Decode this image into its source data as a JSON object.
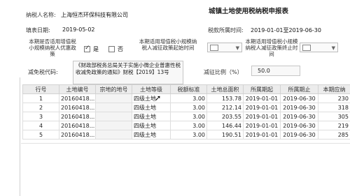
{
  "header": {
    "title": "城镇土地使用税纳税申报表",
    "taxpayer_label": "纳税人名称:",
    "taxpayer_name": "上海恒杰环保科技有限公司",
    "fill_date_label": "填表日期:",
    "fill_date": "2019-05-02",
    "period_label": "税款所属时间:",
    "period_value": "2019-01-01至2019-06-30"
  },
  "form": {
    "small_taxpayer_label": "本期是否适用增值税小规模纳税人优惠政策",
    "yes_label": "是",
    "no_label": "否",
    "yes_checked": true,
    "no_checked": false,
    "start_label": "本期适用增值税小规模纳税人减征政策起始时间",
    "end_label": "本期适用增值税小规模纳税人减征政策终止时间",
    "relief_code_label": "减免税代码:",
    "relief_policy": "《财政部税务总局关于实施小微企业普惠性税收减免政策的通知》财税【2019】13号",
    "reduction_ratio_label": "减征比例（%）",
    "reduction_ratio": "50.0"
  },
  "table": {
    "columns": [
      "行号",
      "土地编号",
      "宗地的地号",
      "土地等级",
      "税额标准",
      "土地总面积",
      "所属期起",
      "所属期止",
      "本期应纳"
    ],
    "rows": [
      {
        "no": "1",
        "code": "20160418...",
        "lot": "",
        "grade": "四级土地",
        "rate": "3.00",
        "area": "153.78",
        "start": "2019-01-01",
        "end": "2019-06-30",
        "due": "230"
      },
      {
        "no": "2",
        "code": "20160418...",
        "lot": "",
        "grade": "四级土地",
        "rate": "3.00",
        "area": "212.14",
        "start": "2019-01-01",
        "end": "2019-06-30",
        "due": "318"
      },
      {
        "no": "3",
        "code": "20160418...",
        "lot": "",
        "grade": "四级土地",
        "rate": "3.00",
        "area": "203.55",
        "start": "2019-01-01",
        "end": "2019-06-30",
        "due": "305"
      },
      {
        "no": "4",
        "code": "20160418...",
        "lot": "",
        "grade": "四级土地",
        "rate": "3.00",
        "area": "146.44",
        "start": "2019-01-01",
        "end": "2019-06-30",
        "due": "219"
      },
      {
        "no": "5",
        "code": "20160418...",
        "lot": "",
        "grade": "四级土地",
        "rate": "3.00",
        "area": "190.51",
        "start": "2019-01-01",
        "end": "2019-06-30",
        "due": "285"
      }
    ]
  },
  "icons": {
    "dropdown": "chevron-down-icon",
    "calendar": "calendar-icon",
    "pointer": "mouse-pointer-icon"
  },
  "colors": {
    "header_bg": "#ececec",
    "border": "#d2d2d2"
  }
}
